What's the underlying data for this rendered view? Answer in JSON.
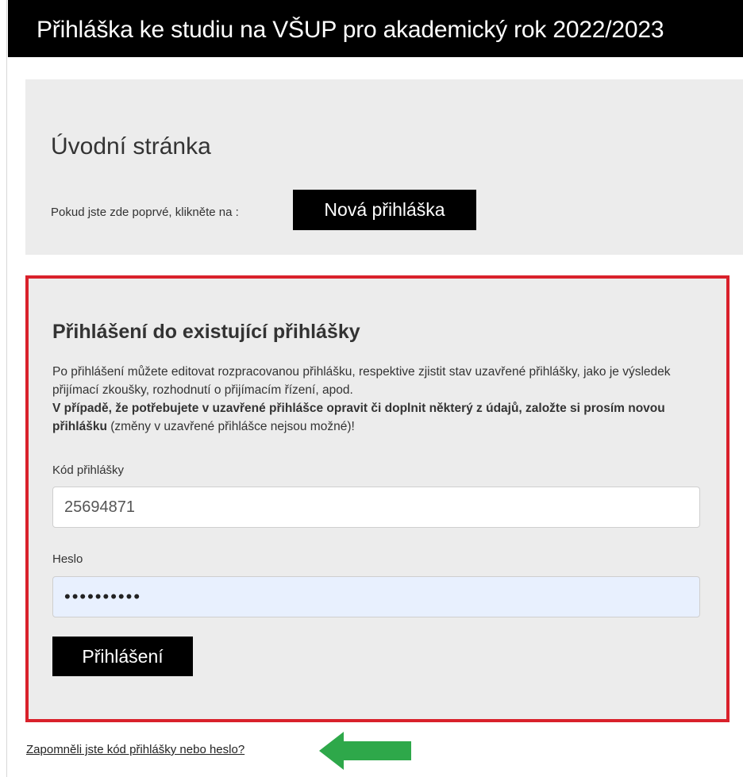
{
  "header": {
    "title": "Přihláška ke studiu na VŠUP pro akademický rok 2022/2023"
  },
  "intro": {
    "heading": "Úvodní stránka",
    "first_time_text": "Pokud jste zde poprvé, klikněte na :",
    "new_application_label": "Nová přihláška"
  },
  "login": {
    "heading": "Přihlášení do existující přihlášky",
    "paragraph_line1": "Po přihlášení můžete editovat rozpracovanou přihlášku, respektive zjistit stav uzavřené přihlášky, jako je výsledek přijímací zkoušky, rozhodnutí o přijímacím řízení, apod.",
    "paragraph_bold": "V případě, že potřebujete v uzavřené přihlášce opravit či doplnit některý z údajů, založte si prosím novou přihlášku",
    "paragraph_after_bold": " (změny v uzavřené přihlášce nejsou možné)!",
    "code_label": "Kód přihlášky",
    "code_value": "25694871",
    "password_label": "Heslo",
    "password_value": "••••••••••",
    "submit_label": "Přihlášení"
  },
  "footer": {
    "forgot_link": "Zapomněli jste kód přihlášky nebo heslo?"
  },
  "colors": {
    "highlight_border": "#d9212b",
    "arrow": "#2ea84a",
    "panel_bg": "#ececec",
    "button_bg": "#000000",
    "autofill_bg": "#e8f0fe"
  },
  "icons": {
    "annotation_arrow": "arrow-left-icon"
  }
}
